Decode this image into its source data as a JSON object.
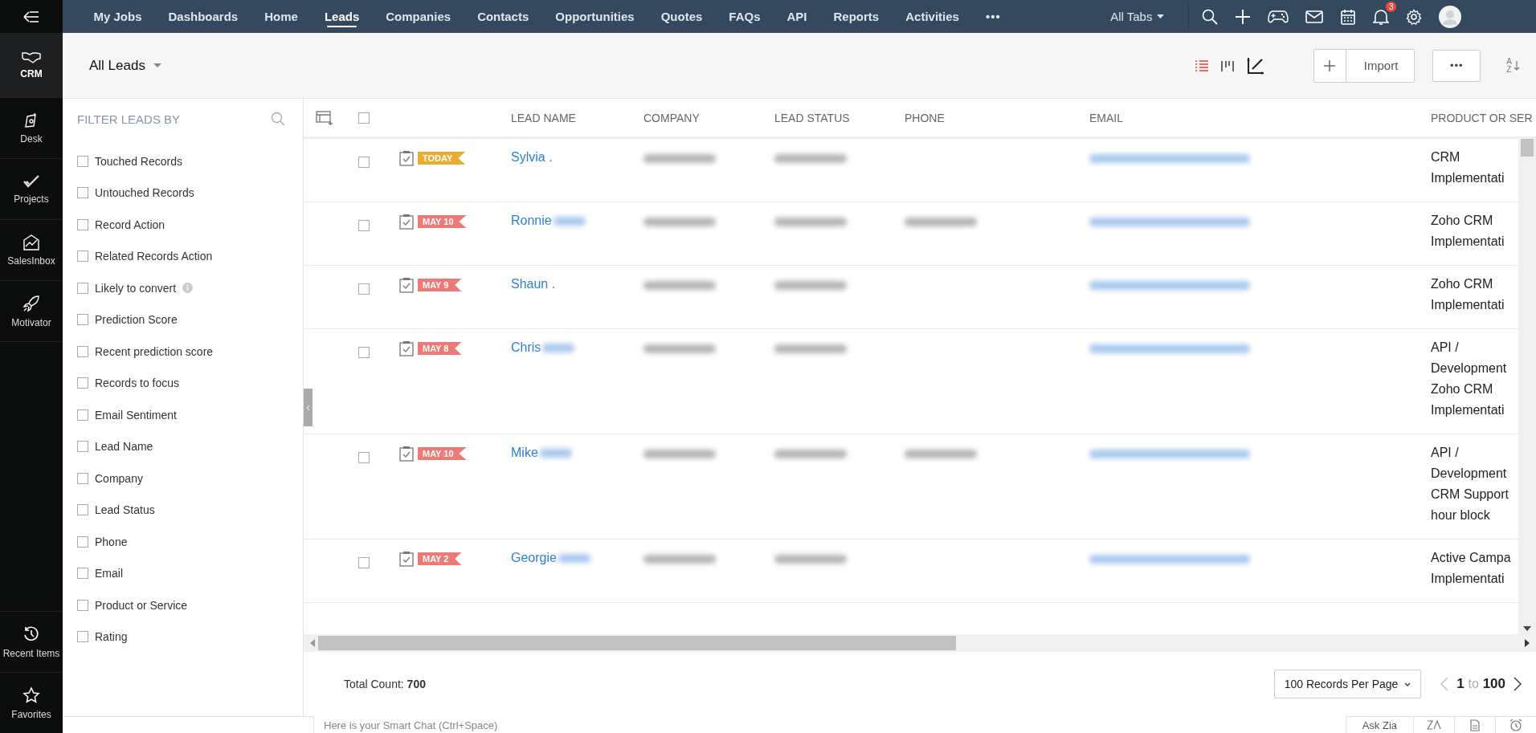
{
  "nav": {
    "items": [
      {
        "label": "My Jobs",
        "selected": false
      },
      {
        "label": "Dashboards",
        "selected": false
      },
      {
        "label": "Home",
        "selected": false
      },
      {
        "label": "Leads",
        "selected": true
      },
      {
        "label": "Companies",
        "selected": false
      },
      {
        "label": "Contacts",
        "selected": false
      },
      {
        "label": "Opportunities",
        "selected": false
      },
      {
        "label": "Quotes",
        "selected": false
      },
      {
        "label": "FAQs",
        "selected": false
      },
      {
        "label": "API",
        "selected": false
      },
      {
        "label": "Reports",
        "selected": false
      },
      {
        "label": "Activities",
        "selected": false
      }
    ],
    "more": "•••",
    "all_tabs": "All Tabs",
    "notification_count": "3"
  },
  "rail": {
    "items": [
      {
        "label": "CRM",
        "selected": true
      },
      {
        "label": "Desk",
        "selected": false
      },
      {
        "label": "Projects",
        "selected": false
      },
      {
        "label": "SalesInbox",
        "selected": false
      },
      {
        "label": "Motivator",
        "selected": false
      }
    ],
    "bottom": [
      {
        "label": "Recent Items"
      },
      {
        "label": "Favorites"
      }
    ]
  },
  "view": {
    "title": "All Leads",
    "import": "Import",
    "more": "•••",
    "sort": {
      "top": "A",
      "bottom": "Z"
    }
  },
  "filter": {
    "title": "FILTER LEADS BY",
    "items": [
      {
        "label": "Touched Records",
        "checked": false,
        "info": false
      },
      {
        "label": "Untouched Records",
        "checked": false,
        "info": false
      },
      {
        "label": "Record Action",
        "checked": false,
        "info": false
      },
      {
        "label": "Related Records Action",
        "checked": false,
        "info": false
      },
      {
        "label": "Likely to convert",
        "checked": false,
        "info": true
      },
      {
        "label": "Prediction Score",
        "checked": false,
        "info": false
      },
      {
        "label": "Recent prediction score",
        "checked": false,
        "info": false
      },
      {
        "label": "Records to focus",
        "checked": false,
        "info": false
      },
      {
        "label": "Email Sentiment",
        "checked": false,
        "info": false
      },
      {
        "label": "Lead Name",
        "checked": false,
        "info": false
      },
      {
        "label": "Company",
        "checked": false,
        "info": false
      },
      {
        "label": "Lead Status",
        "checked": false,
        "info": false
      },
      {
        "label": "Phone",
        "checked": false,
        "info": false
      },
      {
        "label": "Email",
        "checked": false,
        "info": false
      },
      {
        "label": "Product or Service",
        "checked": false,
        "info": false
      },
      {
        "label": "Rating",
        "checked": false,
        "info": false
      }
    ]
  },
  "table": {
    "columns": [
      "LEAD NAME",
      "COMPANY",
      "LEAD STATUS",
      "PHONE",
      "EMAIL",
      "PRODUCT OR SER"
    ],
    "all_selected": false,
    "rows": [
      {
        "selected": false,
        "badge": "TODAY",
        "color": "#e9ad2f",
        "name": "Sylvia .",
        "name_redacted": false,
        "phone_redacted": false,
        "product": [
          "CRM",
          "Implementati"
        ]
      },
      {
        "selected": false,
        "badge": "MAY 10",
        "color": "#ee7a78",
        "name": "Ronnie",
        "name_redacted": true,
        "phone_redacted": true,
        "product": [
          "Zoho CRM",
          "Implementati"
        ]
      },
      {
        "selected": false,
        "badge": "MAY 9",
        "color": "#ee7a78",
        "name": "Shaun .",
        "name_redacted": false,
        "phone_redacted": false,
        "product": [
          "Zoho CRM",
          "Implementati"
        ]
      },
      {
        "selected": false,
        "badge": "MAY 8",
        "color": "#ee7a78",
        "name": "Chris",
        "name_redacted": true,
        "phone_redacted": false,
        "product": [
          "API /",
          "Development",
          "Zoho CRM",
          "Implementati"
        ]
      },
      {
        "selected": false,
        "badge": "MAY 10",
        "color": "#ee7a78",
        "name": "Mike",
        "name_redacted": true,
        "phone_redacted": true,
        "product": [
          "API /",
          "Development",
          "CRM Support",
          "hour block"
        ]
      },
      {
        "selected": false,
        "badge": "MAY 2",
        "color": "#ee7a78",
        "name": "Georgie",
        "name_redacted": true,
        "phone_redacted": false,
        "product": [
          "Active Campa",
          "Implementati"
        ]
      }
    ]
  },
  "footer": {
    "total_label": "Total Count:",
    "total": "700",
    "per_page": "100 Records Per Page",
    "from": "1",
    "to_word": "to",
    "to": "100"
  },
  "chat": {
    "placeholder": "Here is your Smart Chat (Ctrl+Space)",
    "ask_zia": "Ask Zia"
  }
}
